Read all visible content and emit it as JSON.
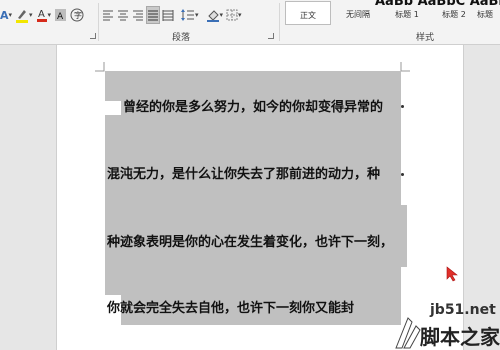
{
  "ribbon": {
    "paragraph_label": "段落",
    "styles_label": "样式",
    "styles": [
      {
        "label": "正文",
        "selected": true
      },
      {
        "label": "无间隔",
        "selected": false
      },
      {
        "label": "标题 1",
        "selected": false
      },
      {
        "label": "标题 2",
        "selected": false
      },
      {
        "label": "标题",
        "selected": false
      }
    ],
    "style_preview": "AaBb AaBbC AaBb",
    "font_tools": [
      "text-effects-icon",
      "highlight-color-icon",
      "font-color-icon",
      "character-shading-icon",
      "enclose-characters-icon"
    ],
    "paragraph_tools": [
      "align-left-icon",
      "align-center-icon",
      "align-right-icon",
      "justify-icon",
      "distributed-icon",
      "line-spacing-icon",
      "shading-icon",
      "borders-icon"
    ],
    "colors": {
      "highlight": "#f2e600",
      "font": "#d62a1a"
    }
  },
  "document": {
    "lines": [
      "曾经的你是多么努力，如今的你却变得异常的",
      "混沌无力，是什么让你失去了那前进的动力，种",
      "种迹象表明是你的心在发生着变化，也许下一刻，",
      "你就会完全失去自他，也许下一刻你又能封"
    ],
    "selection_color": "#c0c0c0"
  },
  "watermark": {
    "site": "jb51.net",
    "name": "脚本之家"
  }
}
